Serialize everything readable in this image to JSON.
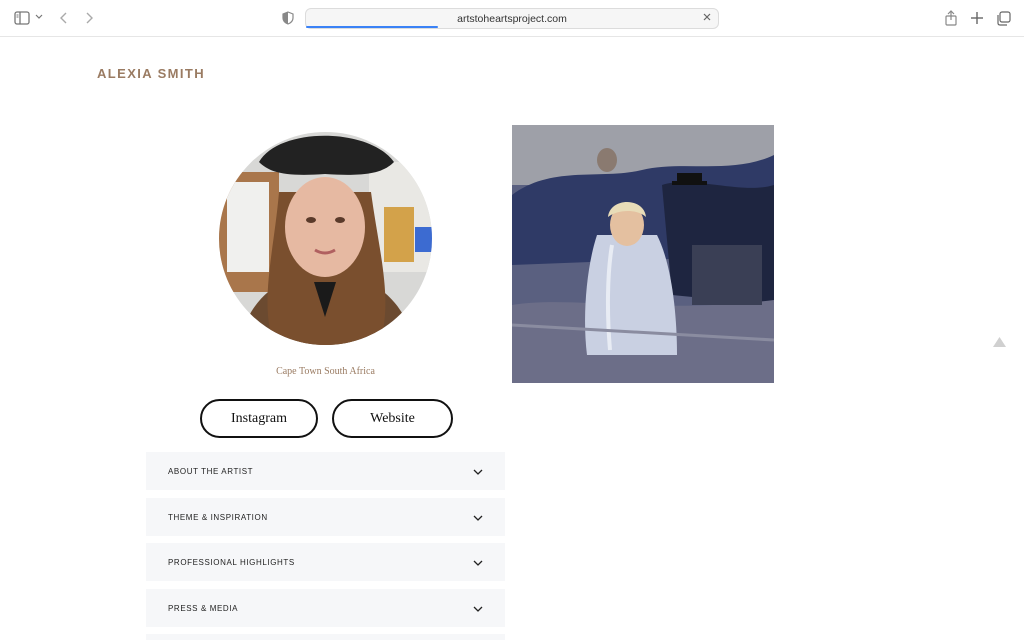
{
  "browser": {
    "url": "artstoheartsproject.com",
    "load_progress": 0.32,
    "icons": {
      "sidebar": "sidebar-icon",
      "back": "chevron-left-icon",
      "forward": "chevron-right-icon",
      "privacy": "shield-half-icon",
      "clear": "close-icon",
      "share": "share-icon",
      "new_tab": "plus-icon",
      "tabs": "tabs-overview-icon"
    }
  },
  "page": {
    "site_title": "ALEXIA SMITH",
    "location": "Cape Town South Africa",
    "buttons": {
      "instagram": "Instagram",
      "website": "Website"
    },
    "accordion": [
      {
        "label": "ABOUT THE ARTIST"
      },
      {
        "label": "THEME & INSPIRATION"
      },
      {
        "label": "PROFESSIONAL HIGHLIGHTS"
      },
      {
        "label": "PRESS & MEDIA"
      }
    ],
    "colors": {
      "accent": "#9a7b62",
      "panel": "#f6f7f9"
    }
  }
}
